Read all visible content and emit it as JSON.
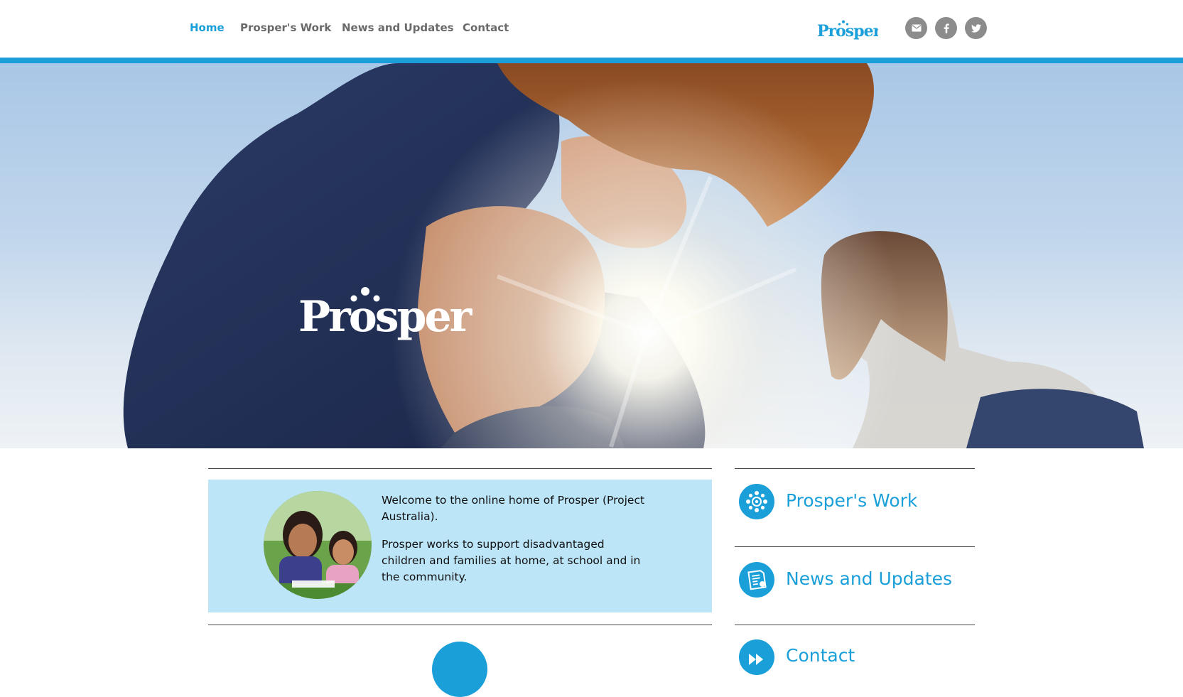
{
  "nav": {
    "items": [
      {
        "label": "Home",
        "active": true
      },
      {
        "label": "Prosper's Work",
        "active": false
      },
      {
        "label": "News and Updates",
        "active": false
      },
      {
        "label": "Contact",
        "active": false
      }
    ]
  },
  "brand": {
    "name": "Prosper",
    "accent_color": "#1a9fd9",
    "light_accent": "#bde5f8"
  },
  "social": [
    {
      "icon": "envelope-icon"
    },
    {
      "icon": "facebook-icon"
    },
    {
      "icon": "twitter-icon"
    }
  ],
  "welcome": {
    "paragraph_1": "Welcome to the online home of Prosper (Project Australia).",
    "paragraph_2": "Prosper works to support disadvantaged children and families at home, at school and in the community."
  },
  "sidebar": {
    "items": [
      {
        "label": "Prosper's Work",
        "icon": "flower-icon"
      },
      {
        "label": "News and Updates",
        "icon": "document-icon"
      },
      {
        "label": "Contact",
        "icon": "speech-icon"
      }
    ]
  }
}
